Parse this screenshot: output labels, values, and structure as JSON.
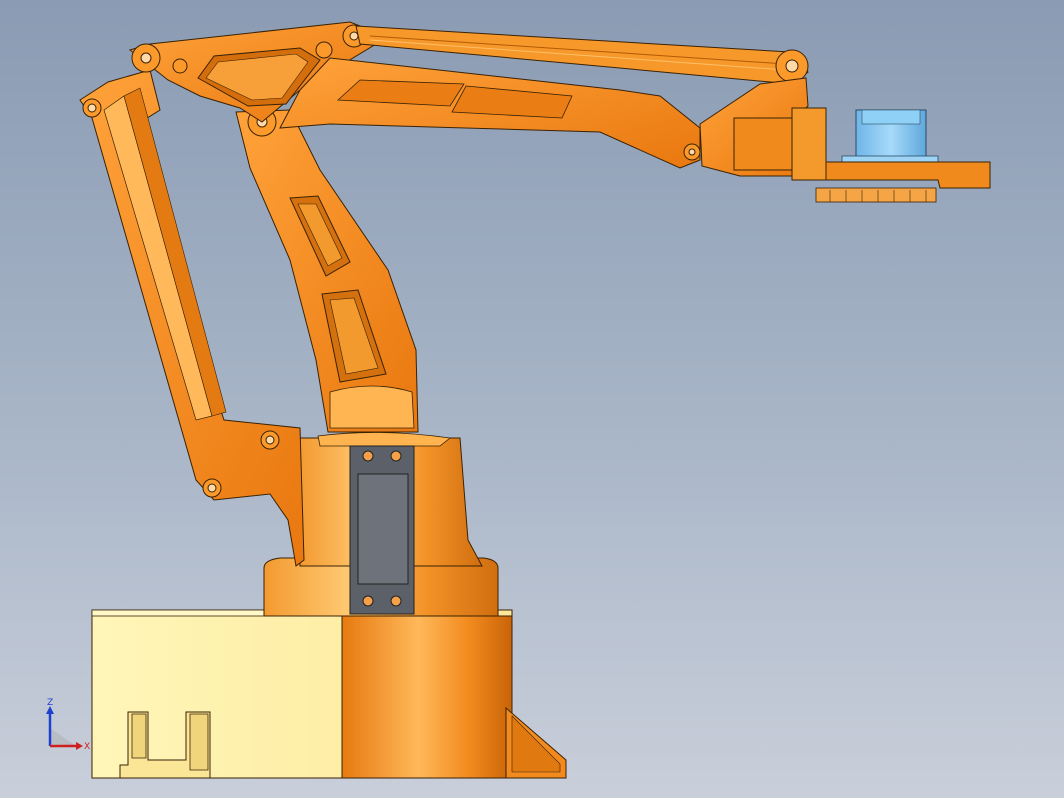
{
  "viewport": {
    "background_top": "#8a9bb3",
    "background_bottom": "#c9cfda"
  },
  "model": {
    "arm_color": "#f08a1c",
    "arm_highlight": "#ffa94a",
    "arm_shadow": "#b85a08",
    "base_block_color": "#fff1a6",
    "gripper_color": "#7fc3f0",
    "motor_color": "#5c6068",
    "edge_color": "#3a2205"
  },
  "triad": {
    "z_label": "Z",
    "x_label": "X",
    "z_color": "#1f3fd0",
    "x_color": "#d01f1f"
  }
}
